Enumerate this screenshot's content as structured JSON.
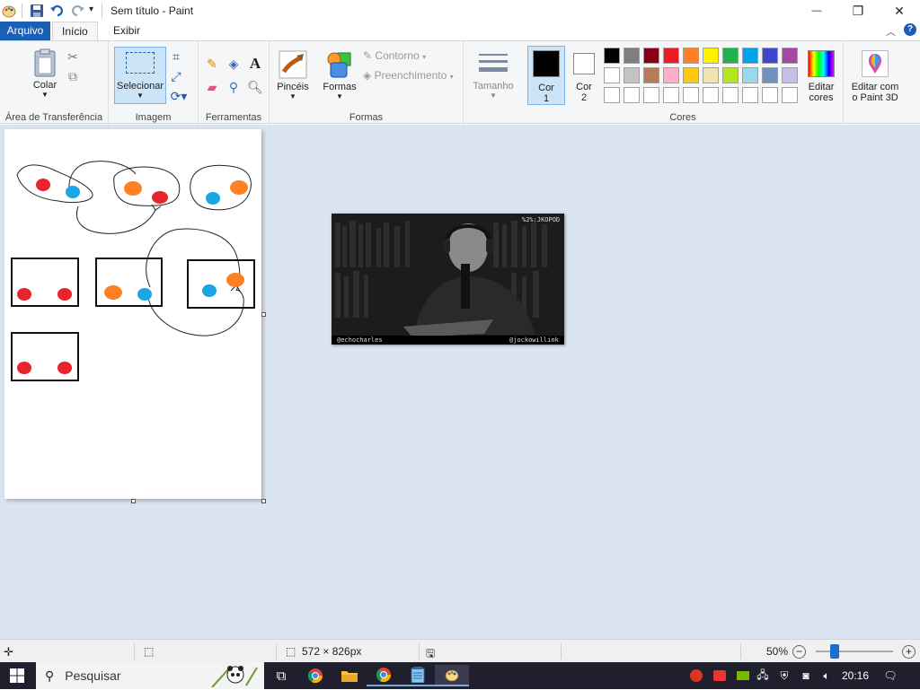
{
  "window": {
    "title": "Sem título - Paint",
    "controls": {
      "minimize": "—",
      "maximize": "❐",
      "close": "✕"
    }
  },
  "ribbon_tabs": [
    {
      "label": "Arquivo",
      "active": false
    },
    {
      "label": "Início",
      "active": true
    },
    {
      "label": "Exibir",
      "active": false
    }
  ],
  "ribbon": {
    "clipboard": {
      "paste_label": "Colar",
      "group_label": "Área de Transferência"
    },
    "image": {
      "select_label": "Selecionar",
      "group_label": "Imagem"
    },
    "tools": {
      "group_label": "Ferramentas",
      "text_tool": "A"
    },
    "brushes": {
      "label": "Pincéis"
    },
    "shapes": {
      "label": "Formas",
      "outline_label": "Contorno",
      "fill_label": "Preenchimento",
      "group_label": "Formas"
    },
    "size": {
      "label": "Tamanho"
    },
    "colors": {
      "color1_label": "Cor\n1",
      "color1_a": "Cor",
      "color1_b": "1",
      "color2_a": "Cor",
      "color2_b": "2",
      "color1": "#000000",
      "color2": "#ffffff",
      "edit_a": "Editar",
      "edit_b": "cores",
      "group_label": "Cores",
      "palette_row1": [
        "#000000",
        "#7f7f7f",
        "#880015",
        "#ed1c24",
        "#ff7f27",
        "#fff200",
        "#22b14c",
        "#00a2e8",
        "#3f48cc",
        "#a349a4"
      ],
      "palette_row2": [
        "#ffffff",
        "#c3c3c3",
        "#b97a57",
        "#ffaec9",
        "#ffc90e",
        "#efe4b0",
        "#b5e61d",
        "#99d9ea",
        "#7092be",
        "#c8bfe7"
      ],
      "palette_row3": [
        "#ffffff",
        "#ffffff",
        "#ffffff",
        "#ffffff",
        "#ffffff",
        "#ffffff",
        "#ffffff",
        "#ffffff",
        "#ffffff",
        "#ffffff"
      ]
    },
    "paint3d": {
      "label_a": "Editar com",
      "label_b": "o Paint 3D"
    }
  },
  "pasted_image": {
    "top_right_text": "%2%:JKOPOD",
    "bottom_left_text": "@echocharles",
    "bottom_right_text": "@jockowillink"
  },
  "statusbar": {
    "dimensions": "572 × 826px",
    "zoom": "50%"
  },
  "taskbar": {
    "search_placeholder": "Pesquisar",
    "clock": "20:16"
  },
  "drawing": {
    "red": "#e8232b",
    "blue": "#1aa5e4",
    "orange": "#ff8022"
  }
}
